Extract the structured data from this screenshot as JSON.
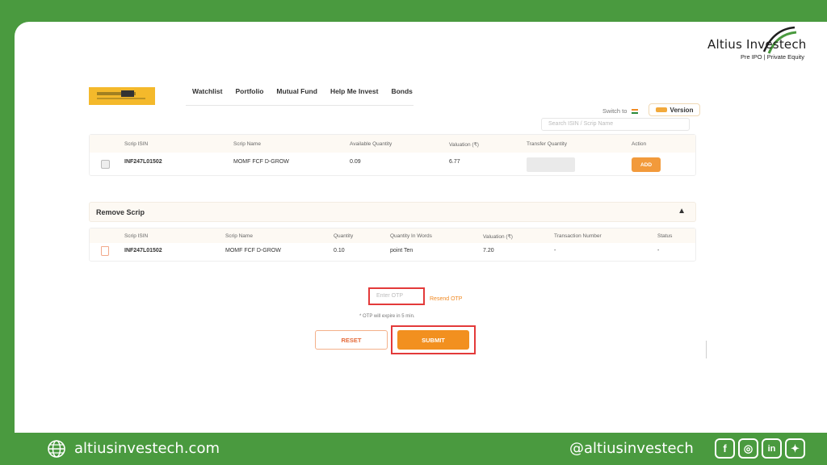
{
  "brand": {
    "title": "Altius Investech",
    "subtitle": "Pre IPO | Private Equity"
  },
  "app": {
    "nav": [
      "Watchlist",
      "Portfolio",
      "Mutual Fund",
      "Help Me Invest",
      "Bonds"
    ],
    "switch_label": "Switch to",
    "version_label": "Version",
    "search_placeholder": "Search ISIN / Scrip Name",
    "table1": {
      "headers": [
        "Scrip ISIN",
        "Scrip Name",
        "Available Quantity",
        "Valuation (₹)",
        "Transfer Quantity",
        "Action"
      ],
      "row": {
        "isin": "INF247L01502",
        "name": "MOMF FCF D-GROW",
        "available_qty": "0.09",
        "valuation": "6.77",
        "action": "ADD"
      }
    },
    "remove_section_title": "Remove Scrip",
    "table2": {
      "headers": [
        "Scrip ISIN",
        "Scrip Name",
        "Quantity",
        "Quantity In Words",
        "Valuation (₹)",
        "Transaction Number",
        "Status"
      ],
      "row": {
        "isin": "INF247L01502",
        "name": "MOMF FCF D-GROW",
        "quantity": "0.10",
        "words": "point Ten",
        "valuation": "7.20",
        "txn": "-",
        "status": "-"
      }
    },
    "otp_placeholder": "Enter OTP",
    "resend_label": "Resend OTP",
    "otp_note": "* OTP will expire in 5 min.",
    "reset_label": "RESET",
    "submit_label": "SUBMIT"
  },
  "footer": {
    "website": "altiusinvestech.com",
    "handle": "@altiusinvestech",
    "icons": [
      "facebook-icon",
      "instagram-icon",
      "linkedin-icon",
      "twitter-icon"
    ]
  },
  "colors": {
    "green": "#4a9a3f",
    "orange": "#f2901f",
    "highlight": "#e33a3a"
  }
}
